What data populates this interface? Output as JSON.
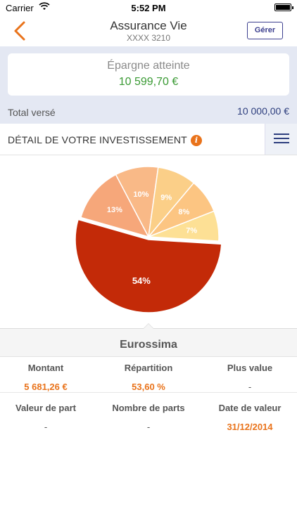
{
  "status_bar": {
    "carrier": "Carrier",
    "time": "5:52 PM"
  },
  "nav": {
    "title": "Assurance Vie",
    "subtitle": "XXXX 3210",
    "manage_label": "Gérer"
  },
  "summary": {
    "label": "Épargne atteinte",
    "value": "10 599,70 €",
    "total_label": "Total versé",
    "total_value": "10 000,00 €"
  },
  "section": {
    "title": "DÉTAIL DE VOTRE INVESTISSEMENT",
    "info_label": "i"
  },
  "chart_data": {
    "type": "pie",
    "slices": [
      {
        "label": "54%",
        "value": 54,
        "color": "#c32a08"
      },
      {
        "label": "13%",
        "value": 13,
        "color": "#f6a77a"
      },
      {
        "label": "10%",
        "value": 10,
        "color": "#f9b987"
      },
      {
        "label": "9%",
        "value": 9,
        "color": "#fbcf88"
      },
      {
        "label": "8%",
        "value": 8,
        "color": "#fcc582"
      },
      {
        "label": "7%",
        "value": 7,
        "color": "#fde095"
      }
    ]
  },
  "detail": {
    "fund_name": "Eurossima",
    "row1": [
      {
        "header": "Montant",
        "value": "5 681,26 €",
        "highlight": true
      },
      {
        "header": "Répartition",
        "value": "53,60 %",
        "highlight": true
      },
      {
        "header": "Plus value",
        "value": "-",
        "highlight": false
      }
    ],
    "row2": [
      {
        "header": "Valeur de part",
        "value": "-",
        "highlight": false
      },
      {
        "header": "Nombre de parts",
        "value": "-",
        "highlight": false
      },
      {
        "header": "Date de valeur",
        "value": "31/12/2014",
        "highlight": true
      }
    ]
  },
  "colors": {
    "accent": "#e9731b",
    "brand": "#2d3e7e",
    "positive": "#3a9a34"
  }
}
